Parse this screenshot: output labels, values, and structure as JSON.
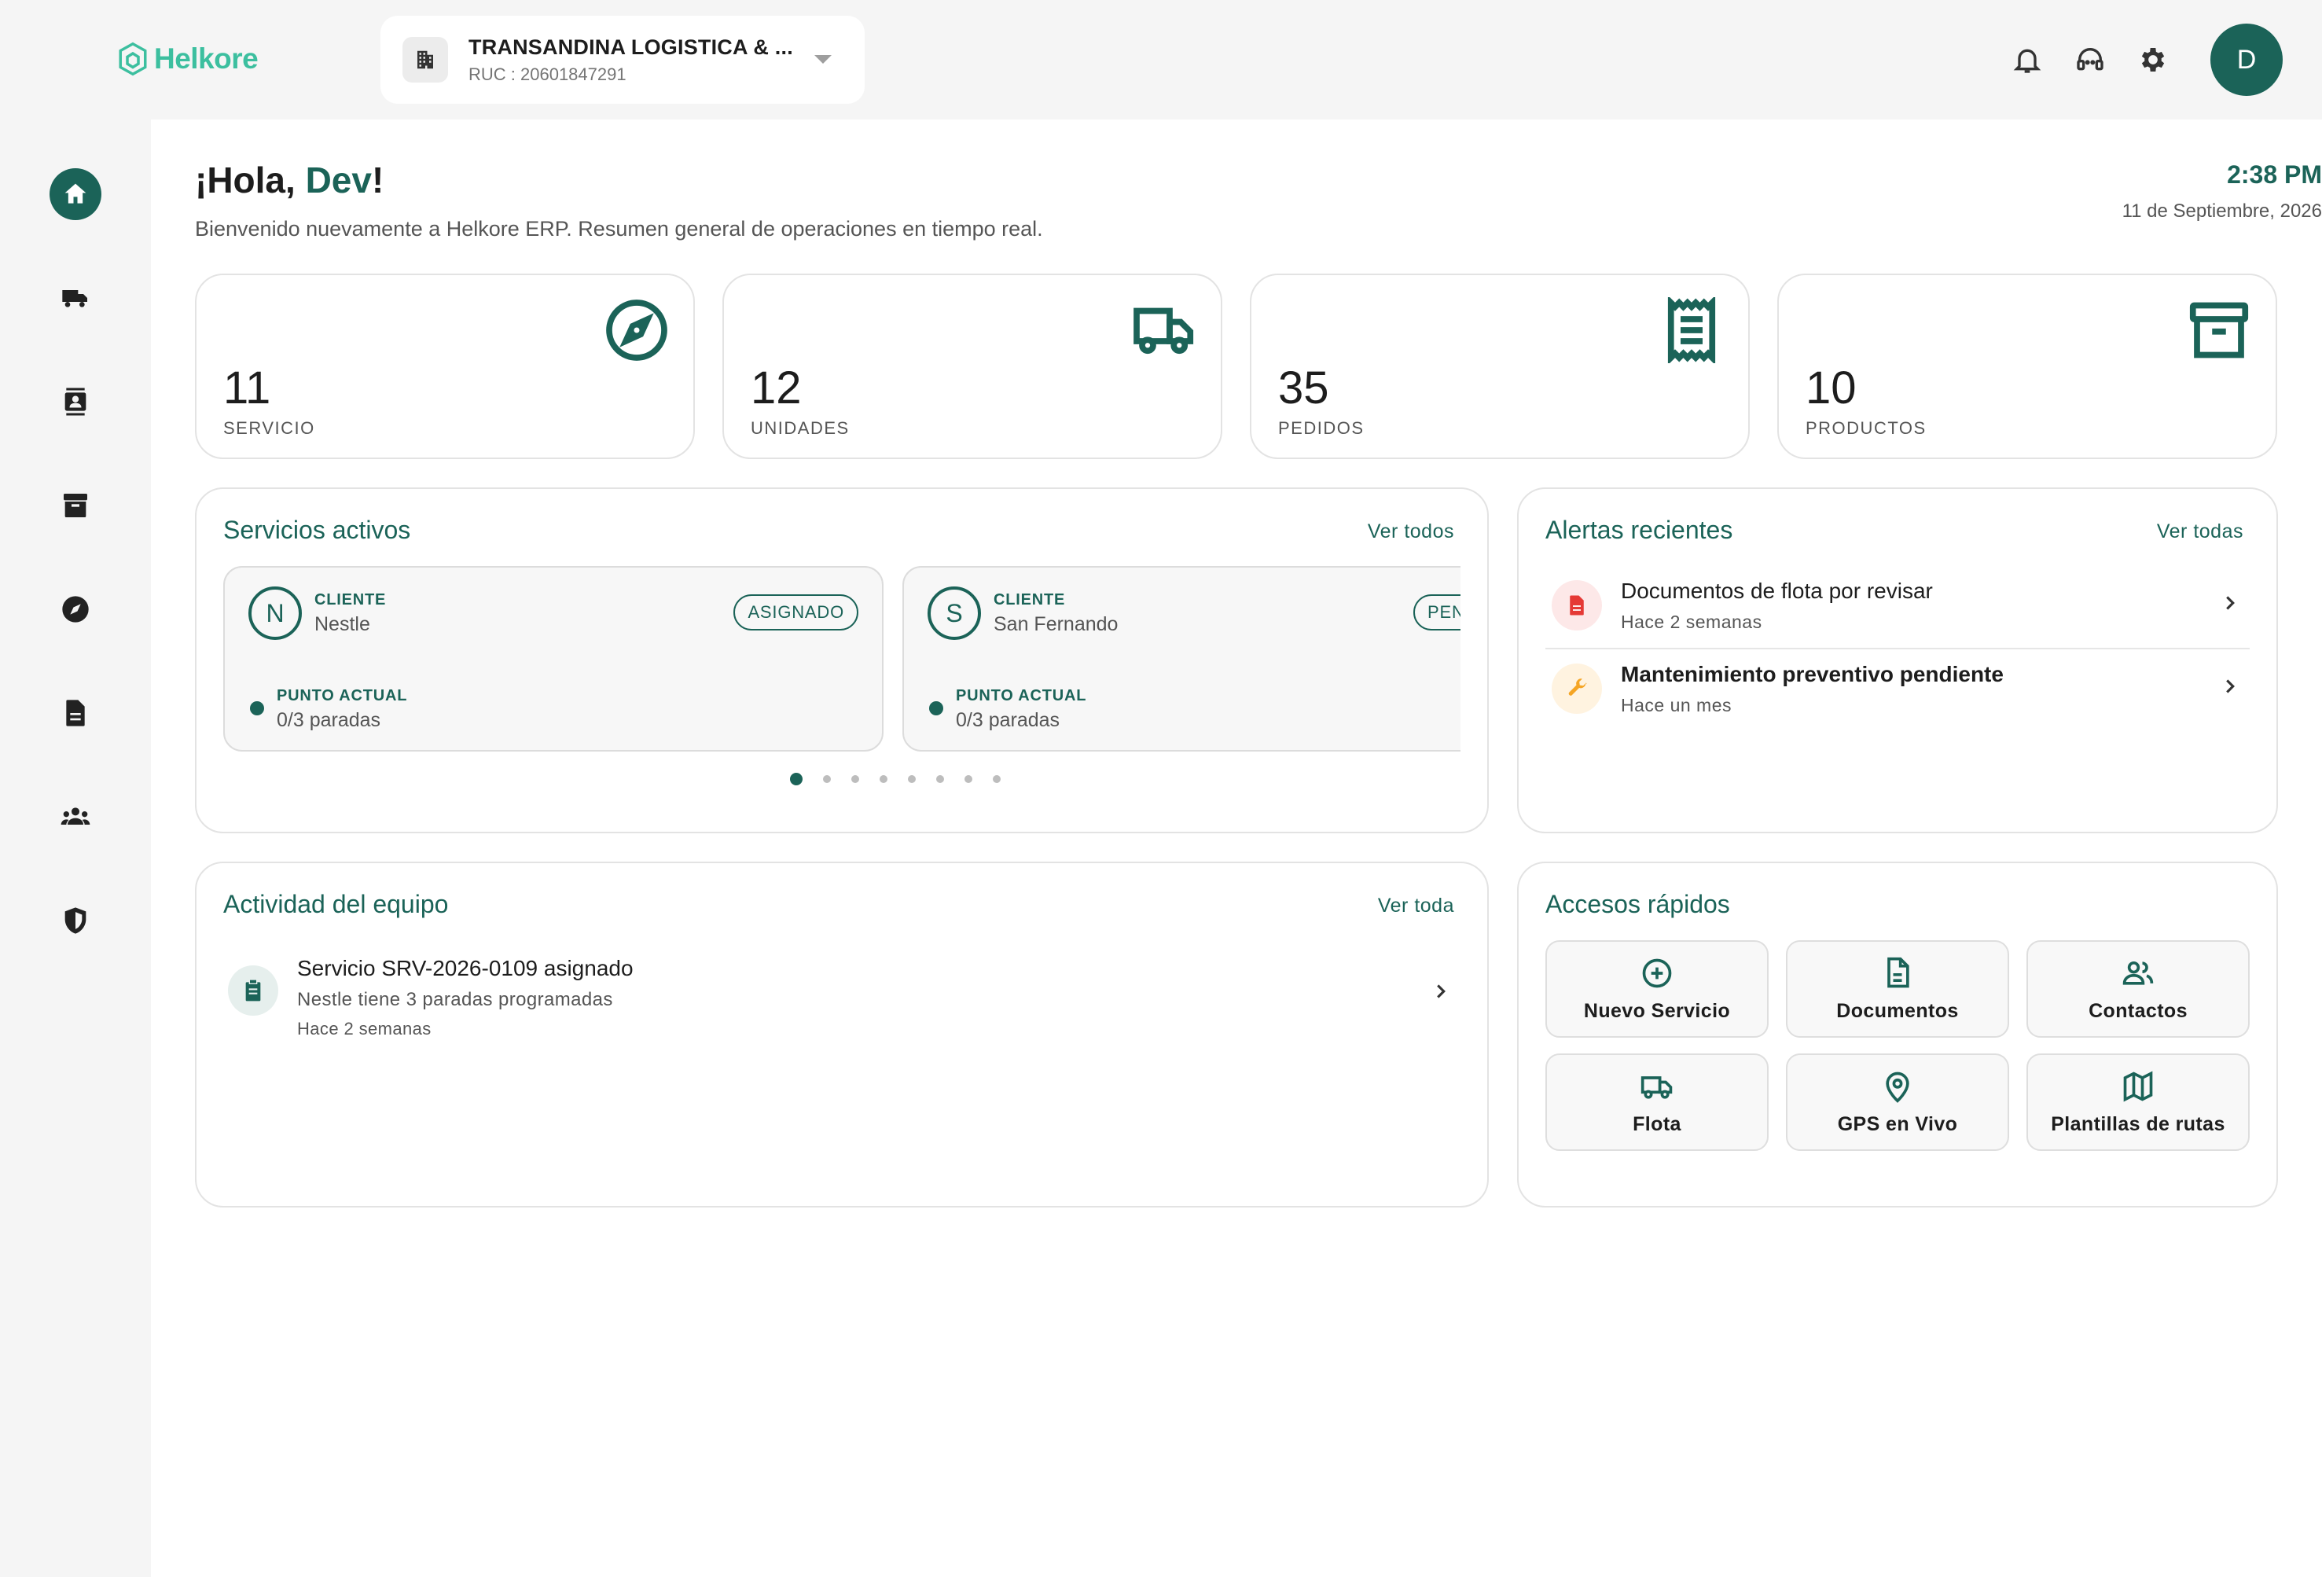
{
  "brand": {
    "name": "Helkore"
  },
  "company": {
    "name": "TRANSANDINA LOGISTICA & ...",
    "ruc": "RUC : 20601847291"
  },
  "user": {
    "initial": "D"
  },
  "greeting": {
    "prefix": "¡Hola, ",
    "name": "Dev",
    "suffix": "!",
    "subtitle": "Bienvenido nuevamente a Helkore ERP. Resumen general de operaciones en tiempo real."
  },
  "clock": {
    "time": "2:38 PM",
    "date": "11 de Septiembre, 2026"
  },
  "stats": [
    {
      "value": "11",
      "label": "SERVICIO",
      "icon": "compass-icon"
    },
    {
      "value": "12",
      "label": "UNIDADES",
      "icon": "truck-icon"
    },
    {
      "value": "35",
      "label": "PEDIDOS",
      "icon": "receipt-icon"
    },
    {
      "value": "10",
      "label": "PRODUCTOS",
      "icon": "archive-box-icon"
    }
  ],
  "services": {
    "title": "Servicios activos",
    "link": "Ver todos",
    "items": [
      {
        "initial": "N",
        "kicker": "CLIENTE",
        "client": "Nestle",
        "status": "ASIGNADO",
        "point_label": "PUNTO ACTUAL",
        "point_value": "0/3 paradas"
      },
      {
        "initial": "S",
        "kicker": "CLIENTE",
        "client": "San Fernando",
        "status": "PENDIENTE",
        "point_label": "PUNTO ACTUAL",
        "point_value": "0/3 paradas"
      }
    ],
    "pages": 8,
    "current_page": 1
  },
  "alerts": {
    "title": "Alertas recientes",
    "link": "Ver todas",
    "items": [
      {
        "title": "Documentos de flota por revisar",
        "time": "Hace 2 semanas",
        "icon": "document-alert-icon",
        "color": "#e53935",
        "bg": "#fde8e8"
      },
      {
        "title": "Mantenimiento preventivo pendiente",
        "time": "Hace un mes",
        "icon": "wrench-icon",
        "color": "#f5a524",
        "bg": "#fff3e0"
      }
    ]
  },
  "activity": {
    "title": "Actividad del equipo",
    "link": "Ver toda",
    "items": [
      {
        "title": "Servicio SRV-2026-0109 asignado",
        "detail": "Nestle tiene 3 paradas programadas",
        "time": "Hace 2 semanas",
        "icon": "clipboard-icon"
      }
    ]
  },
  "quick": {
    "title": "Accesos rápidos",
    "items": [
      {
        "label": "Nuevo Servicio",
        "icon": "plus-circle-icon"
      },
      {
        "label": "Documentos",
        "icon": "document-icon"
      },
      {
        "label": "Contactos",
        "icon": "people-icon"
      },
      {
        "label": "Flota",
        "icon": "truck-icon"
      },
      {
        "label": "GPS en Vivo",
        "icon": "map-pin-icon"
      },
      {
        "label": "Plantillas de rutas",
        "icon": "map-icon"
      }
    ]
  },
  "sidebar": {
    "items": [
      {
        "icon": "home-icon",
        "active": true
      },
      {
        "icon": "truck-icon"
      },
      {
        "icon": "contacts-icon"
      },
      {
        "icon": "archive-icon"
      },
      {
        "icon": "compass-icon"
      },
      {
        "icon": "document-icon"
      },
      {
        "icon": "team-icon"
      },
      {
        "icon": "shield-icon"
      }
    ]
  },
  "colors": {
    "primary": "#1b6358",
    "brand": "#3cbf9f",
    "background": "#f5f5f5"
  }
}
